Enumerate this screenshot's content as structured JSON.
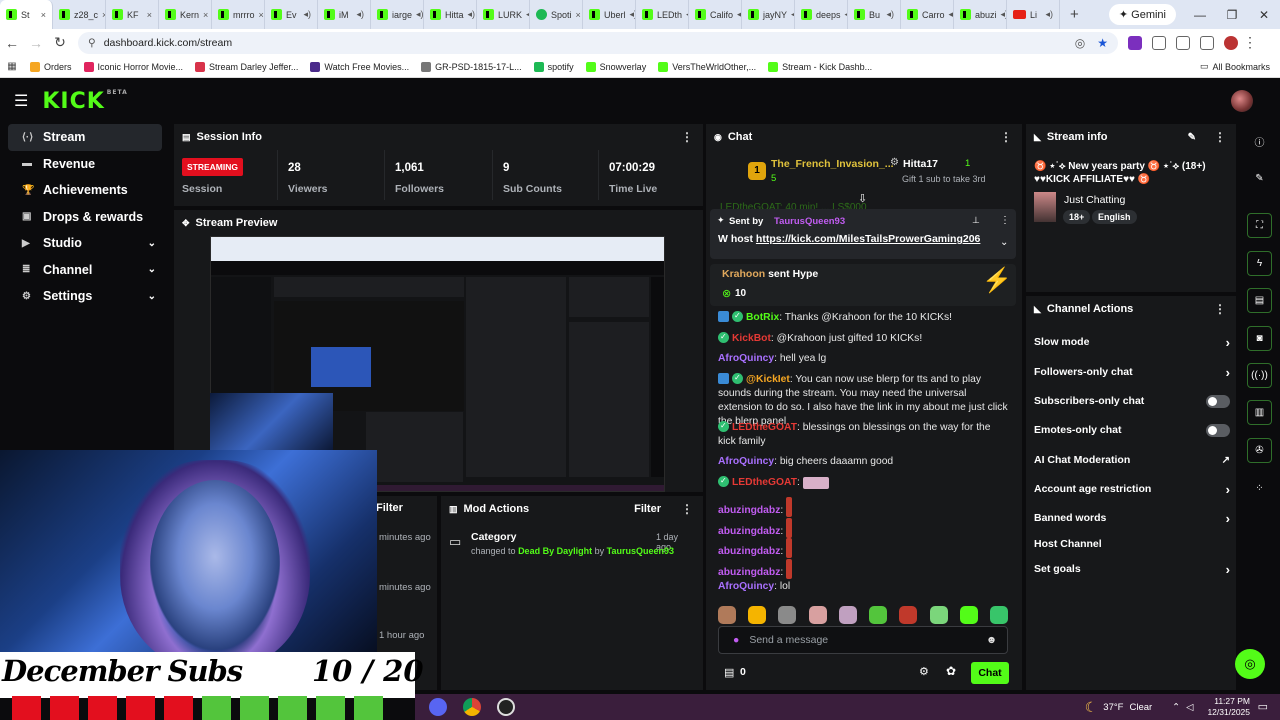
{
  "browser": {
    "tabs": [
      {
        "label": "St",
        "icon": "kick"
      },
      {
        "label": "z28_c",
        "icon": "kick"
      },
      {
        "label": "KF",
        "icon": "kick"
      },
      {
        "label": "Kern",
        "icon": "kick"
      },
      {
        "label": "mrrro",
        "icon": "kick"
      },
      {
        "label": "Ev",
        "icon": "kick"
      },
      {
        "label": "iM",
        "icon": "kick"
      },
      {
        "label": "iarge",
        "icon": "kick"
      },
      {
        "label": "Hitta",
        "icon": "kick"
      },
      {
        "label": "LURK",
        "icon": "kick"
      },
      {
        "label": "Spoti",
        "icon": "spotify"
      },
      {
        "label": "Uberl",
        "icon": "kick"
      },
      {
        "label": "LEDth",
        "icon": "kick"
      },
      {
        "label": "Califo",
        "icon": "kick"
      },
      {
        "label": "jayNY",
        "icon": "kick"
      },
      {
        "label": "deeps",
        "icon": "kick"
      },
      {
        "label": "Bu",
        "icon": "kick"
      },
      {
        "label": "Carro",
        "icon": "kick"
      },
      {
        "label": "abuzi",
        "icon": "kick"
      },
      {
        "label": "Li",
        "icon": "youtube"
      }
    ],
    "new_tab": "+",
    "gemini": "Gemini",
    "url": "dashboard.kick.com/stream",
    "bookmarks": [
      {
        "label": "Orders",
        "color": "#f5a623"
      },
      {
        "label": "Iconic Horror Movie...",
        "color": "#e0245e"
      },
      {
        "label": "Stream Darley Jeffer...",
        "color": "#d8334a"
      },
      {
        "label": "Watch Free Movies...",
        "color": "#4a2a8a"
      },
      {
        "label": "GR-PSD-1815-17-L...",
        "color": "#777777"
      },
      {
        "label": "spotify",
        "color": "#1db954"
      },
      {
        "label": "Snowverlay",
        "color": "#53fc18"
      },
      {
        "label": "VersTheWrldOther,...",
        "color": "#53fc18"
      },
      {
        "label": "Stream - Kick Dashb...",
        "color": "#53fc18"
      }
    ],
    "all_bookmarks": "All Bookmarks"
  },
  "header": {
    "logo": "KICK",
    "beta": "BETA"
  },
  "sidebar": {
    "items": [
      {
        "label": "Stream",
        "icon": "⟨·⟩"
      },
      {
        "label": "Revenue",
        "icon": "▬"
      },
      {
        "label": "Achievements",
        "icon": "🏆"
      },
      {
        "label": "Drops & rewards",
        "icon": "▣"
      },
      {
        "label": "Studio",
        "icon": "▶",
        "chevron": "⌄"
      },
      {
        "label": "Channel",
        "icon": "≣",
        "chevron": "⌄"
      },
      {
        "label": "Settings",
        "icon": "⚙",
        "chevron": "⌄"
      }
    ]
  },
  "session": {
    "title": "Session Info",
    "badge": "STREAMING",
    "session_label": "Session",
    "stats": [
      {
        "value": "28",
        "label": "Viewers"
      },
      {
        "value": "1,061",
        "label": "Followers"
      },
      {
        "value": "9",
        "label": "Sub Counts"
      },
      {
        "value": "07:00:29",
        "label": "Time Live"
      }
    ]
  },
  "preview": {
    "title": "Stream Preview"
  },
  "overlay": {
    "subs_label": "December Subs",
    "subs_count": "10 / 20",
    "subs_filled": 10,
    "subs_total": 20
  },
  "activity": {
    "filter": "Filter",
    "times": [
      "minutes ago",
      "minutes ago",
      "1 hour ago"
    ]
  },
  "mod_actions": {
    "title": "Mod Actions",
    "filter": "Filter",
    "entries": [
      {
        "title": "Category",
        "time": "1 day ago",
        "prefix": "changed to",
        "value": "Dead By Daylight",
        "by": "by",
        "user": "TaurusQueen93"
      }
    ]
  },
  "chat": {
    "title": "Chat",
    "leader": {
      "rank": "1",
      "name": "The_French_Invasion_...",
      "count": "5",
      "gifter": "Hitta17",
      "gifter_count": "1",
      "gift_text": "Gift 1 sub to take 3rd"
    },
    "truncated_line": "LEDtheGOAT: 40 min! ... LS$000",
    "pinned": {
      "sent_by": "Sent by",
      "user": "TaurusQueen93",
      "text_prefix": "W host",
      "link": "https://kick.com/MilesTailsProwerGaming206"
    },
    "hype": {
      "user": "Krahoon",
      "text": "sent Hype",
      "amount": "10"
    },
    "messages": [
      {
        "user": "BotRix",
        "color": "#53fc18",
        "text": "Thanks @Krahoon for the 10 KICKs!"
      },
      {
        "user": "KickBot",
        "color": "#e53935",
        "text": "@Krahoon just gifted 10 KICKs!"
      },
      {
        "user": "AfroQuincy",
        "color": "#a970ff",
        "text": "hell yea lg"
      },
      {
        "user": "@KickIet",
        "color": "#f5a623",
        "text": "You can now use blerp for tts and to play sounds during the stream. You may need the universal extension to do so. I also have the link in my about me just click the blerp panel"
      },
      {
        "user": "LEDtheGOAT",
        "color": "#e53935",
        "text": "blessings on blessings on the way for the kick family"
      },
      {
        "user": "AfroQuincy",
        "color": "#a970ff",
        "text": "big cheers daaamn good"
      },
      {
        "user": "LEDtheGOAT",
        "color": "#e53935",
        "text": ""
      },
      {
        "user": "abuzingdabz",
        "color": "#c05cf0",
        "text": ""
      },
      {
        "user": "abuzingdabz",
        "color": "#c05cf0",
        "text": ""
      },
      {
        "user": "abuzingdabz",
        "color": "#c05cf0",
        "text": ""
      },
      {
        "user": "abuzingdabz",
        "color": "#c05cf0",
        "text": ""
      },
      {
        "user": "AfroQuincy",
        "color": "#a970ff",
        "text": "lol"
      }
    ],
    "input_placeholder": "Send a message",
    "kicks": "0",
    "send_label": "Chat"
  },
  "stream_info": {
    "title": "Stream info",
    "stream_title": "♉ ⋆˙⟡ New years party ♉ ⋆˙⟡ (18+) ♥♥KICK AFFILIATE♥♥ ♉",
    "category": "Just Chatting",
    "tags": [
      "18+",
      "English"
    ]
  },
  "channel_actions": {
    "title": "Channel Actions",
    "items": [
      {
        "label": "Slow mode",
        "control": "chevron"
      },
      {
        "label": "Followers-only chat",
        "control": "chevron"
      },
      {
        "label": "Subscribers-only chat",
        "control": "toggle"
      },
      {
        "label": "Emotes-only chat",
        "control": "toggle"
      },
      {
        "label": "AI Chat Moderation",
        "control": "external"
      },
      {
        "label": "Account age restriction",
        "control": "chevron"
      },
      {
        "label": "Banned words",
        "control": "chevron"
      },
      {
        "label": "Host Channel",
        "control": "none"
      },
      {
        "label": "Set goals",
        "control": "chevron"
      }
    ]
  },
  "taskbar": {
    "temp": "37°F",
    "condition": "Clear",
    "time": "11:27 PM",
    "date": "12/31/2025"
  },
  "colors": {
    "accent": "#53fc18",
    "live": "#e30f1e",
    "panel": "#17181a",
    "bg": "#0b0b0d"
  }
}
